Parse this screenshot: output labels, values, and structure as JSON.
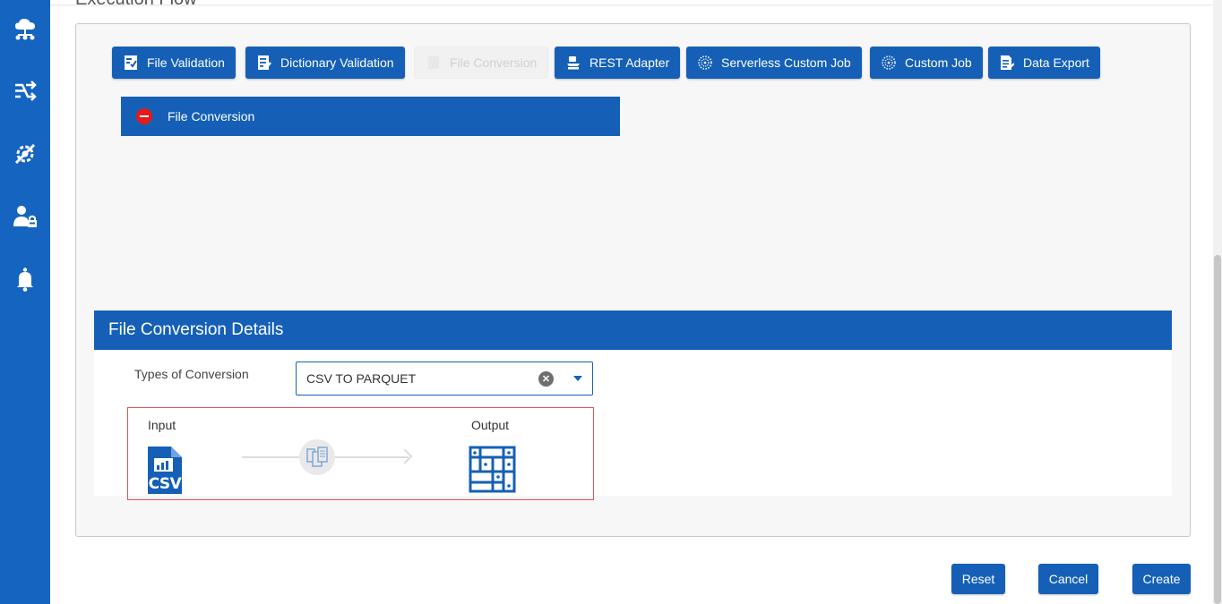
{
  "page": {
    "section_title": "Execution Flow"
  },
  "sidebar": {
    "icons": [
      "cloud-network-icon",
      "workflow-arrows-icon",
      "tools-gear-icon",
      "user-lock-icon",
      "bell-icon"
    ]
  },
  "toolbar": {
    "buttons": [
      {
        "label": "File Validation",
        "icon": "file-check-icon",
        "enabled": true
      },
      {
        "label": "Dictionary Validation",
        "icon": "file-edit-icon",
        "enabled": true
      },
      {
        "label": "File Conversion",
        "icon": "file-convert-icon",
        "enabled": false
      },
      {
        "label": "REST Adapter",
        "icon": "adapter-icon",
        "enabled": true
      },
      {
        "label": "Serverless Custom Job",
        "icon": "dotted-circle-icon",
        "enabled": true
      },
      {
        "label": "Custom Job",
        "icon": "dotted-circle-icon",
        "enabled": true
      },
      {
        "label": "Data Export",
        "icon": "document-export-icon",
        "enabled": true
      }
    ]
  },
  "flow": {
    "items": [
      {
        "label": "File Conversion"
      }
    ]
  },
  "details": {
    "title": "File Conversion Details",
    "conversion_label": "Types of Conversion",
    "conversion_value": "CSV TO PARQUET",
    "input_label": "Input",
    "output_label": "Output",
    "input_file_badge": "CSV"
  },
  "actions": {
    "reset": "Reset",
    "cancel": "Cancel",
    "create": "Create"
  },
  "colors": {
    "primary": "#1560b6",
    "sidebar": "#1565c0",
    "remove": "#e31b1b",
    "highlight_border": "#e05555"
  }
}
